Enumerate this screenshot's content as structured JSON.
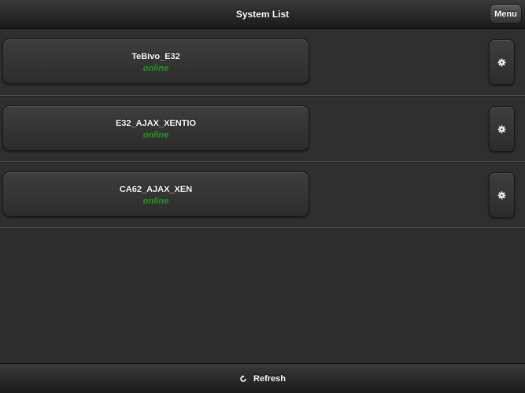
{
  "header": {
    "title": "System List",
    "menu_label": "Menu"
  },
  "systems": [
    {
      "name": "TeBivo_E32",
      "status": "online"
    },
    {
      "name": "E32_AJAX_XENTIO",
      "status": "online"
    },
    {
      "name": "CA62_AJAX_XEN",
      "status": "online"
    }
  ],
  "footer": {
    "refresh_label": "Refresh"
  },
  "icons": {
    "settings": "gear-icon",
    "refresh": "refresh-icon"
  },
  "colors": {
    "status_online": "#1e9a1e",
    "background": "#2d2d2d"
  }
}
